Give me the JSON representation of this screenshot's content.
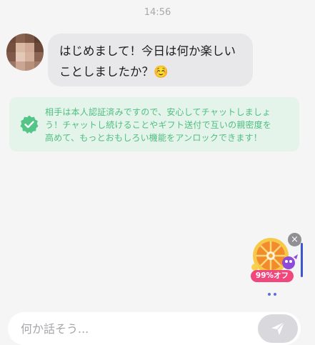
{
  "chat": {
    "timestamp": "14:56",
    "message": {
      "line1": "はじめまして！今日は何か楽しい",
      "line2": "ことしましたか？",
      "emoji": "☺️"
    }
  },
  "notice": {
    "icon": "verified-badge-icon",
    "line1": "相手は本人認証済みですので、安心してチャットしましょ",
    "line2": "う！チャットし続けることやギフト送付で互いの親密度を",
    "line3": "高めて、もっとおもしろい機能をアンロックできます！"
  },
  "promo": {
    "badge": "99%オフ",
    "icon": "roulette-wheel-icon",
    "close_icon": "close-icon"
  },
  "composer": {
    "placeholder": "何か話そう...",
    "send_icon": "send-icon"
  },
  "colors": {
    "background": "#f5f5f6",
    "bubble": "#e8e8ea",
    "notice_bg": "#e4f4ea",
    "notice_text": "#4fbe80",
    "badge": "#f0477d",
    "send_button": "#d9d9dd"
  }
}
